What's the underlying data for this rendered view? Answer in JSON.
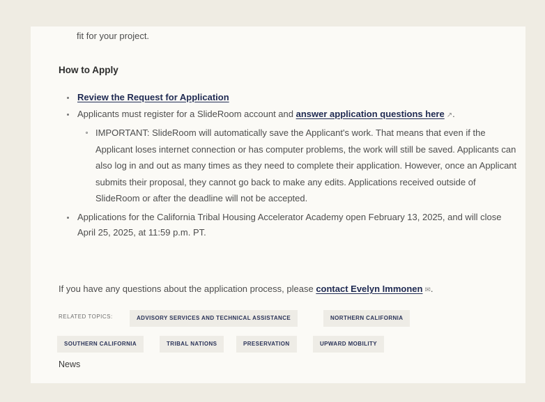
{
  "intro_text": "fit for your project.",
  "heading": "How to Apply",
  "items": {
    "review_link": "Review the Request for Application",
    "register_text": "Applicants must register for a SlideRoom account and ",
    "register_link": "answer application questions here",
    "register_ext": "↗",
    "register_end": ".",
    "important_text": "IMPORTANT: SlideRoom will automatically save the Applicant's work. That means that even if the Applicant loses internet connection or has computer problems, the work will still be saved. Applicants can also log in and out as many times as they need to complete their application. However, once an Applicant submits their proposal, they cannot go back to make any edits. Applications received outside of SlideRoom or after the deadline will not be accepted.",
    "dates_text": "Applications for the California Tribal Housing Accelerator Academy open February 13, 2025, and will close April 25, 2025, at 11:59 p.m. PT."
  },
  "contact": {
    "text": "If you have any questions about the application process, please ",
    "link": "contact Evelyn Immonen",
    "icon": "✉",
    "end": "."
  },
  "related": {
    "label": "RELATED TOPICS:",
    "tags": [
      "ADVISORY SERVICES AND TECHNICAL ASSISTANCE",
      "NORTHERN CALIFORNIA",
      "SOUTHERN CALIFORNIA",
      "TRIBAL NATIONS",
      "PRESERVATION",
      "UPWARD MOBILITY"
    ]
  },
  "news_label": "News"
}
